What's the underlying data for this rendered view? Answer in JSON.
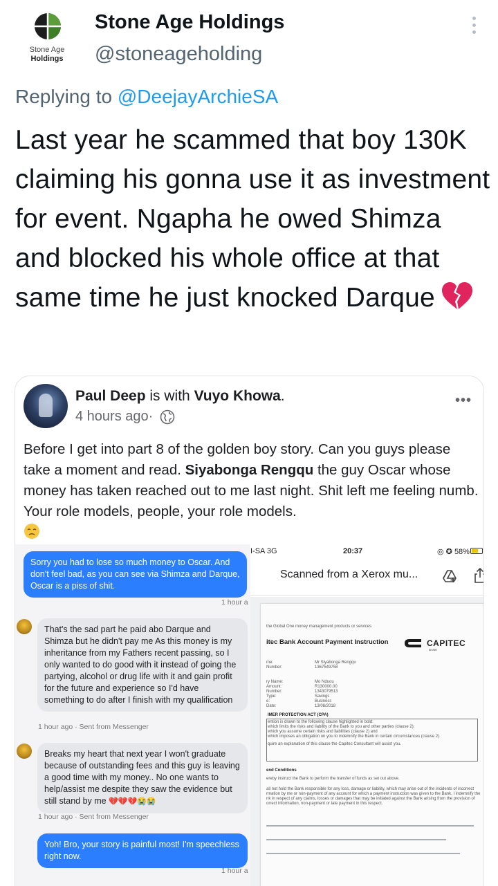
{
  "tweet": {
    "author_name": "Stone Age Holdings",
    "author_handle": "@stoneageholding",
    "logo_line1": "Stone Age",
    "logo_line2": "Holdings",
    "replying_prefix": "Replying to ",
    "replying_to": "@DeejayArchieSA",
    "text": "Last year he scammed that boy 130K claiming his gonna use it as investment for event. Ngapha he owed Shimza and blocked his whole office at that same time he just knocked Darque",
    "text_emoji": "broken-heart-icon"
  },
  "embed": {
    "fb_author": "Paul Deep",
    "fb_with": " is with ",
    "fb_tagged": "Vuyo Khowa",
    "fb_period": ".",
    "fb_time": "4 hours ago",
    "fb_sep": " · ",
    "fb_more": "•••",
    "post_part1": "Before I get into part 8 of the golden boy story. Can you guys please take a moment and read. ",
    "post_bold": "Siyabonga Rengqu",
    "post_part2": " the guy Oscar whose money has taken reached out to me last night. Shit left me feeling numb. Your role models, people, your role models.",
    "messenger": {
      "msg1": "Sorry you had to lose so much money to Oscar. And don't feel bad, as you can see via Shimza and Darque, Oscar is a piss of shit.",
      "msg1_time": "1 hour a",
      "msg2": "That's the sad part he paid abo Darque and Shimza but he didn't pay me As this money is my inheritance from my Fathers recent passing, so I only wanted to do good with it instead of going the partying, alcohol or drug life with it and gain profit for the future and experience so I'd have something to do after I finish with my qualification",
      "msg2_time": "1 hour ago · Sent from Messenger",
      "msg3": "Breaks my heart that next year I won't graduate because of outstanding fees and this guy is leaving a good time with my money.. No one wants to help/assist me despite they saw the evidence but still stand by me",
      "msg3_emoji": "💔💔💔😭😭",
      "msg3_time": "1 hour ago · Sent from Messenger",
      "msg4": "Yoh! Bro, your story is painful most! I'm speechless right now.",
      "msg4_time": "1 hour a"
    },
    "phone": {
      "carrier": "I-SA  3G",
      "time": "20:37",
      "battery": "58%",
      "app_title": "Scanned from a Xerox mu...",
      "doc_heading": "itec Bank Account Payment Instruction",
      "brand": "CAPITEC",
      "brand_sub": "BANK",
      "doc_section1": "IMER PROTECTION ACT (CPA)",
      "doc_section2": "end Conditions",
      "doc_lines": [
        "the Global One money management products or services",
        "me:",
        "Number:",
        "Mr Siyabonga Rengqu",
        "1367549758",
        "ry Name:",
        "Amount:",
        "Number:",
        "Type:",
        "e:",
        "Date:",
        "Mo Nduou",
        "R130000.00",
        "1343079513",
        "Savings",
        "Business",
        "13/08/2018",
        "ention is drawn to the following clause highlighted in bold:",
        "which limits the risks and liability of the Bank to you and other parties (clause 2);",
        "which you assume certain risks and liabilities (clause 2) and",
        "which imposes an obligation on you to indemnify the Bank in certain circumstances (clause 2).",
        "quire an explanation of this clause the Capitec Consultant will assist you.",
        "ereby instruct the Bank to perform the transfer of funds as set out above.",
        "all not hold the Bank responsible for any loss, damage or liability, which may arise out of the incidents of incorrect",
        "rmation by me or non-payment of any account for which a payment instruction was given to the Bank. I indemnify the",
        "nk in respect of any claims, losses or damages that may be initiated against the Bank arising from the provision of",
        "orrect information, non-payment or late payment in this respect."
      ]
    }
  },
  "colors": {
    "link": "#1d9bf0",
    "secondary_text": "#536471",
    "messenger_blue": "#2b7fff",
    "heart_red": "#e0245e"
  }
}
